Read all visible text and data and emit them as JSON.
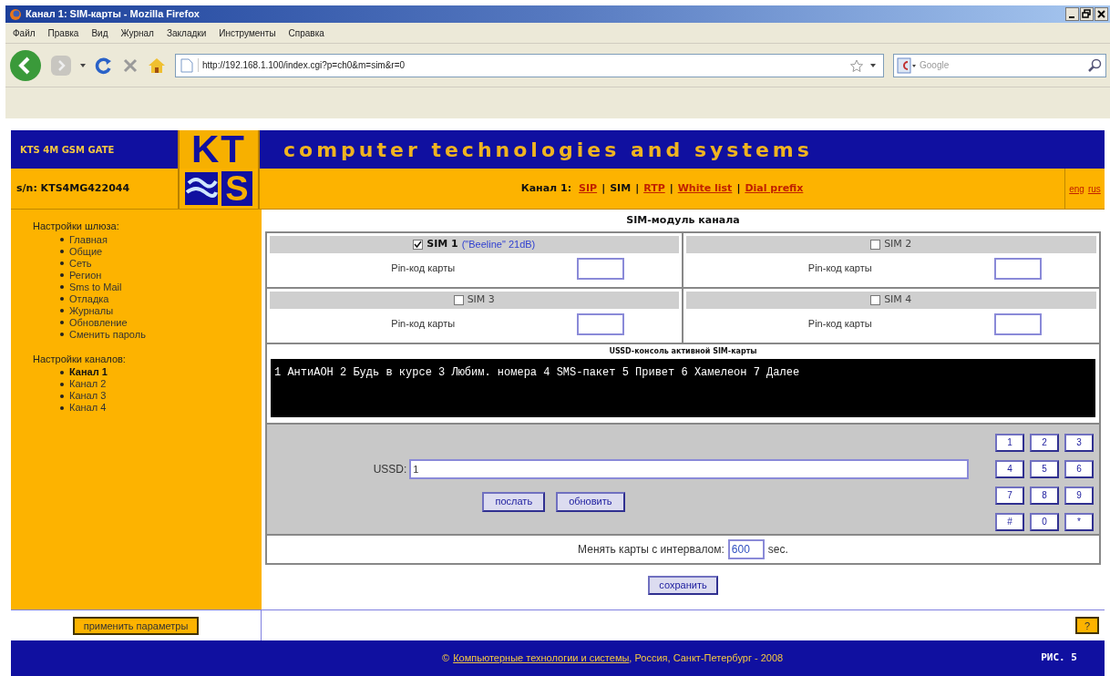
{
  "browser": {
    "title": "Канал 1:  SIM-карты - Mozilla Firefox",
    "menu": [
      "Файл",
      "Правка",
      "Вид",
      "Журнал",
      "Закладки",
      "Инструменты",
      "Справка"
    ],
    "url": "http://192.168.1.100/index.cgi?p=ch0&m=sim&r=0",
    "search_placeholder": "Google"
  },
  "header": {
    "product": "KTS 4M GSM GATE",
    "serial": "s/n: KTS4MG422044",
    "logo_top": "KT",
    "logo_bottom": "S",
    "tagline": "computer technologies and systems"
  },
  "channel_nav": {
    "label": "Канал 1:",
    "links": [
      {
        "label": "SIP",
        "selected": false
      },
      {
        "label": "SIM",
        "selected": true
      },
      {
        "label": "RTP",
        "selected": false
      },
      {
        "label": "White list",
        "selected": false
      },
      {
        "label": "Dial prefix",
        "selected": false
      }
    ],
    "separator": "|",
    "languages": [
      "eng",
      "rus"
    ]
  },
  "sidebar": [
    {
      "title": "Настройки шлюза:",
      "items": [
        {
          "label": "Главная",
          "selected": false
        },
        {
          "label": "Общие",
          "selected": false
        },
        {
          "label": "Сеть",
          "selected": false
        },
        {
          "label": "Регион",
          "selected": false
        },
        {
          "label": "Sms to Mail",
          "selected": false
        },
        {
          "label": "Отладка",
          "selected": false
        },
        {
          "label": "Журналы",
          "selected": false
        },
        {
          "label": "Обновление",
          "selected": false
        },
        {
          "label": "Сменить пароль",
          "selected": false
        }
      ]
    },
    {
      "title": "Настройки каналов:",
      "items": [
        {
          "label": "Канал 1",
          "selected": true
        },
        {
          "label": "Канал 2",
          "selected": false
        },
        {
          "label": "Канал 3",
          "selected": false
        },
        {
          "label": "Канал 4",
          "selected": false
        }
      ]
    }
  ],
  "content": {
    "title": "SIM-модуль канала",
    "sims": [
      {
        "label": "SIM 1",
        "checked": true,
        "status": "(\"Beeline\" 21dB)",
        "pin_label": "Pin-код карты"
      },
      {
        "label": "SIM 2",
        "checked": false,
        "pin_label": "Pin-код карты"
      },
      {
        "label": "SIM 3",
        "checked": false,
        "pin_label": "Pin-код карты"
      },
      {
        "label": "SIM 4",
        "checked": false,
        "pin_label": "Pin-код карты"
      }
    ],
    "console_title": "USSD-консоль активной SIM-карты",
    "console_text": "1 АнтиАОН 2 Будь в курсе 3 Любим. номера 4 SMS-пакет 5 Привет 6 Хамелеон 7 Далее",
    "ussd_label": "USSD:",
    "ussd_value": "1",
    "ussd_buttons": [
      "послать",
      "обновить"
    ],
    "keypad": [
      "1",
      "2",
      "3",
      "4",
      "5",
      "6",
      "7",
      "8",
      "9",
      "#",
      "0",
      "*"
    ],
    "interval_label": "Менять карты с интервалом:",
    "interval_value": "600",
    "interval_unit": "sec.",
    "save_button": "сохранить"
  },
  "apply_button": "применить параметры",
  "help_button": "?",
  "footer": {
    "copyright": "©",
    "link": "Компьютерные технологии и системы",
    "text": ", Россия, Санкт-Петербург - 2008",
    "figure": "РИС. 5"
  }
}
